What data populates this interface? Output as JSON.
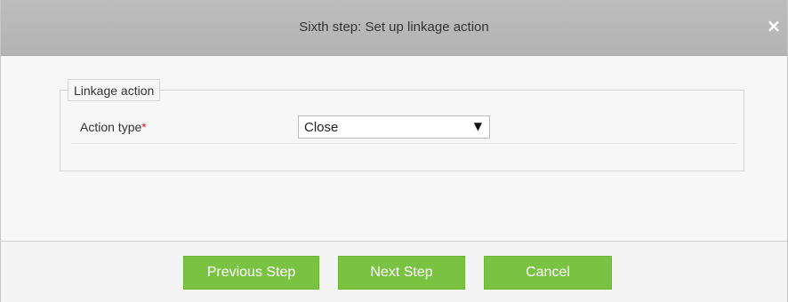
{
  "dialog": {
    "title": "Sixth step: Set up linkage action",
    "close_glyph": "×"
  },
  "fieldset": {
    "legend": "Linkage action",
    "action_type": {
      "label": "Action type",
      "required_mark": "*",
      "selected": "Close",
      "dropdown_glyph": "▼"
    }
  },
  "buttons": {
    "previous": "Previous Step",
    "next": "Next Step",
    "cancel": "Cancel"
  },
  "colors": {
    "button_green": "#79c242",
    "titlebar_gray": "#b8b8b8",
    "required_red": "#e02020"
  }
}
